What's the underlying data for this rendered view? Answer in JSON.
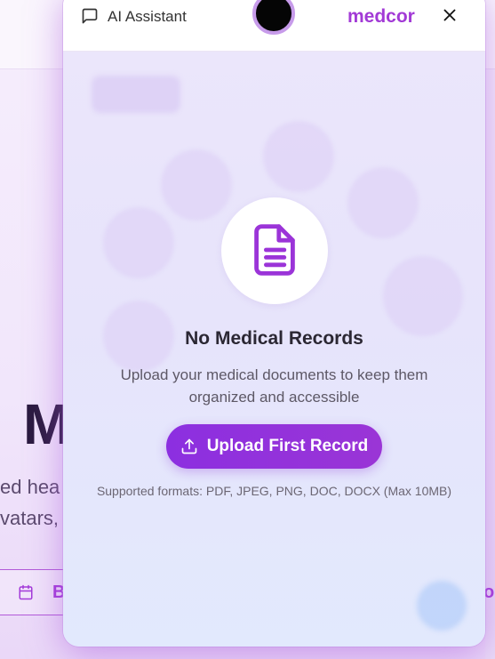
{
  "background": {
    "hero_letter": "M",
    "line1": "ed hea",
    "line2": "vatars,",
    "band_label": "B",
    "band_right_letter": "o"
  },
  "panel": {
    "header": {
      "assistant_label": "AI Assistant",
      "brand": "medcor",
      "icons": {
        "chat": "chat-bubble-icon",
        "close": "close-icon",
        "avatar": "avatar"
      }
    },
    "empty_state": {
      "icon": "document-icon",
      "title": "No Medical Records",
      "description": "Upload your medical documents to keep them organized and accessible",
      "button_label": "Upload First Record",
      "button_icon": "upload-icon",
      "formats": "Supported formats: PDF, JPEG, PNG, DOC, DOCX (Max 10MB)"
    }
  },
  "colors": {
    "accent": "#9b34d8",
    "button": "#8c2fe0",
    "brand": "#a23ad6"
  }
}
